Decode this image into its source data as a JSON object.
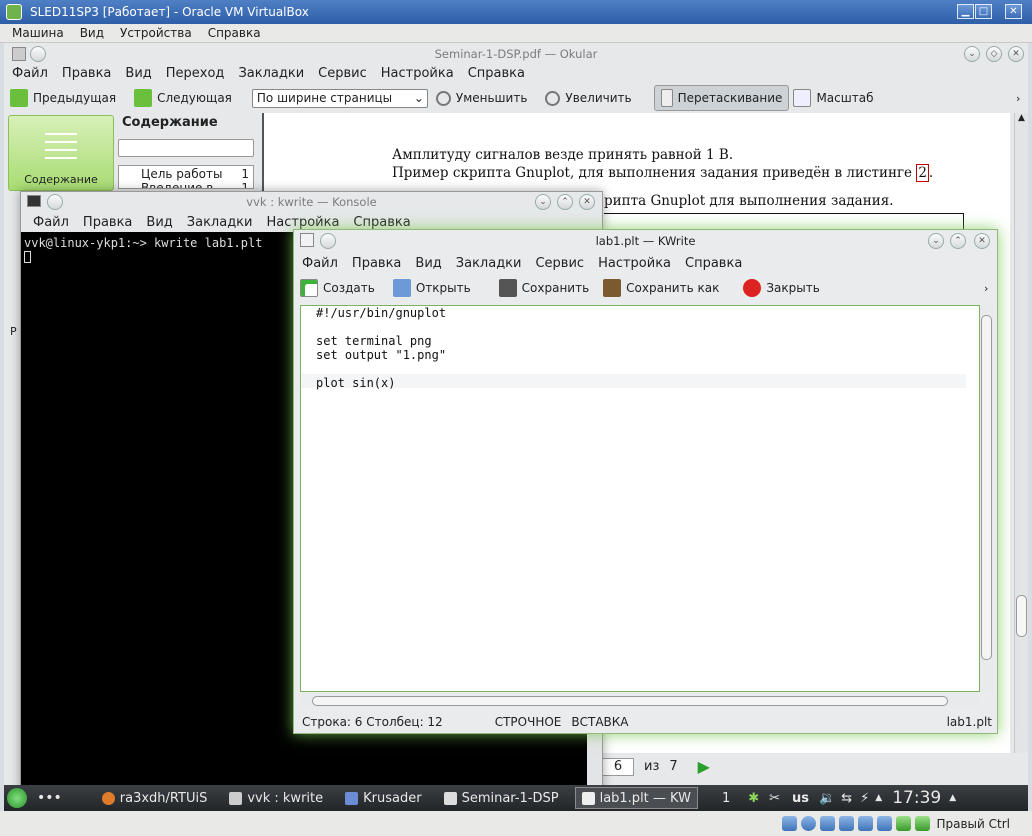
{
  "vbox": {
    "title": "SLED11SP3 [Работает] - Oracle VM VirtualBox",
    "menu": [
      "Машина",
      "Вид",
      "Устройства",
      "Справка"
    ],
    "status_text": "Правый Ctrl"
  },
  "okular": {
    "title": "Seminar-1-DSP.pdf — Okular",
    "menu": [
      "Файл",
      "Правка",
      "Вид",
      "Переход",
      "Закладки",
      "Сервис",
      "Настройка",
      "Справка"
    ],
    "toolbar": {
      "prev": "Предыдущая",
      "next": "Следующая",
      "zoom_mode": "По ширине страницы",
      "zoom_out": "Уменьшить",
      "zoom_in": "Увеличить",
      "drag": "Перетаскивание",
      "zoom": "Масштаб"
    },
    "sidebar_button": "Содержание",
    "toc_title": "Содержание",
    "toc": [
      {
        "label": "Цель работы",
        "page": "1"
      },
      {
        "label": "Введение в...",
        "page": "1"
      }
    ],
    "pdf_lines": [
      "Амплитуду сигналов везде принять равной 1 В.",
      "Пример скрипта Gnuplot, для выполнения задания приведён в листинге",
      "рипта Gnuplot для выполнения задания."
    ],
    "pdf_ref": "2",
    "page_current": "6",
    "page_of": "из",
    "page_total": "7",
    "side_letter": "Р"
  },
  "konsole": {
    "title": "vvk : kwrite — Konsole",
    "menu": [
      "Файл",
      "Правка",
      "Вид",
      "Закладки",
      "Настройка",
      "Справка"
    ],
    "line": "vvk@linux-ykp1:~> kwrite lab1.plt"
  },
  "kwrite": {
    "title": "lab1.plt — KWrite",
    "menu": [
      "Файл",
      "Правка",
      "Вид",
      "Закладки",
      "Сервис",
      "Настройка",
      "Справка"
    ],
    "toolbar": {
      "new": "Создать",
      "open": "Открыть",
      "save": "Сохранить",
      "save_as": "Сохранить как",
      "close": "Закрыть"
    },
    "code": [
      "#!/usr/bin/gnuplot",
      "",
      "set terminal png",
      "set output \"1.png\"",
      "",
      "plot sin(x)"
    ],
    "status": {
      "position": "Строка: 6 Столбец: 12",
      "mode": "СТРОЧНОЕ",
      "insert": "ВСТАВКА",
      "file": "lab1.plt"
    }
  },
  "taskbar": {
    "tasks": [
      "ra3xdh/RTUiS",
      "vvk : kwrite",
      "Krusader",
      "Seminar-1-DSP",
      "lab1.plt — KW"
    ],
    "desktop": "1",
    "layout": "us",
    "clock": "17:39"
  },
  "colors": {
    "accent_green": "#7db35d",
    "link_red": "#c00000",
    "title_blue": "#2e5ea8"
  }
}
